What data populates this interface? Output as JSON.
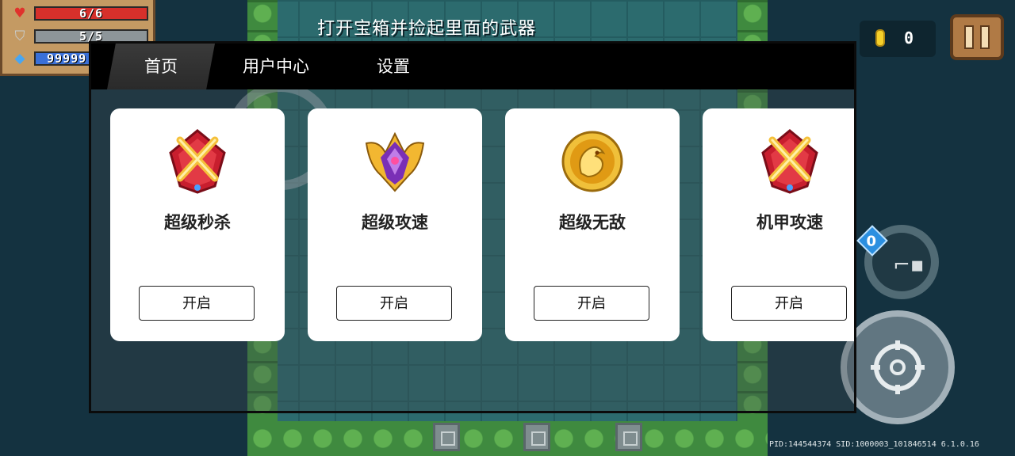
{
  "hud": {
    "health": {
      "text": "6/6",
      "fraction": 1.0,
      "color": "#d6302b"
    },
    "armor": {
      "text": "5/5",
      "fraction": 1.0,
      "color": "#8d9599"
    },
    "energy": {
      "text": "99999",
      "fraction": 1.0,
      "color": "#3a70d8"
    },
    "tip": "打开宝箱并捡起里面的武器",
    "coins": "0",
    "energy_badge": "0",
    "build_info": "PID:144544374 SID:1000003_101846514 6.1.0.16"
  },
  "tabs": [
    {
      "label": "首页",
      "active": true
    },
    {
      "label": "用户中心",
      "active": false
    },
    {
      "label": "设置",
      "active": false
    }
  ],
  "cards": [
    {
      "title": "超级秒杀",
      "button": "开启",
      "badge_icon": "crossed-swords-badge-icon"
    },
    {
      "title": "超级攻速",
      "button": "开启",
      "badge_icon": "winged-purple-badge-icon"
    },
    {
      "title": "超级无敌",
      "button": "开启",
      "badge_icon": "golden-dragon-badge-icon"
    },
    {
      "title": "机甲攻速",
      "button": "开启",
      "badge_icon": "crossed-swords-badge-icon"
    }
  ],
  "colors": {
    "panel_tabbar": "#000000",
    "card_bg": "#ffffff",
    "floor": "#2c6b6e",
    "wall": "#3f8a3f"
  }
}
